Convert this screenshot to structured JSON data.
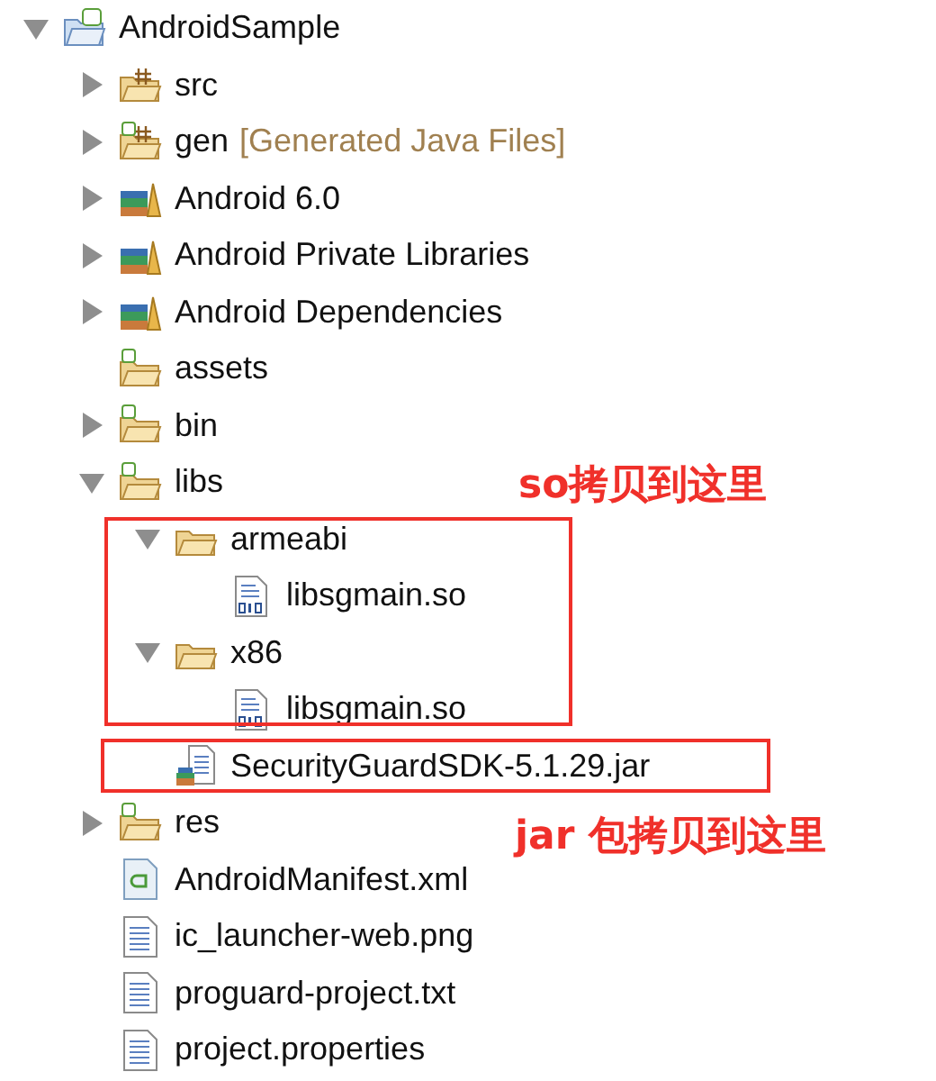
{
  "tree": {
    "label": "AndroidSample",
    "kind": "project",
    "expanded": true,
    "children": [
      {
        "label": "src",
        "kind": "package-folder",
        "expanded": false
      },
      {
        "label": "gen",
        "note": "[Generated Java Files]",
        "kind": "android-package-folder",
        "expanded": false
      },
      {
        "label": "Android 6.0",
        "kind": "library",
        "expanded": false
      },
      {
        "label": "Android Private Libraries",
        "kind": "library",
        "expanded": false
      },
      {
        "label": "Android Dependencies",
        "kind": "library",
        "expanded": false
      },
      {
        "label": "assets",
        "kind": "android-folder"
      },
      {
        "label": "bin",
        "kind": "android-folder",
        "expanded": false
      },
      {
        "label": "libs",
        "kind": "android-folder",
        "expanded": true,
        "children": [
          {
            "label": "armeabi",
            "kind": "folder",
            "expanded": true,
            "children": [
              {
                "label": "libsgmain.so",
                "kind": "binary"
              }
            ]
          },
          {
            "label": "x86",
            "kind": "folder",
            "expanded": true,
            "children": [
              {
                "label": "libsgmain.so",
                "kind": "binary"
              }
            ]
          },
          {
            "label": "SecurityGuardSDK-5.1.29.jar",
            "kind": "jar"
          }
        ]
      },
      {
        "label": "res",
        "kind": "android-folder",
        "expanded": false
      },
      {
        "label": "AndroidManifest.xml",
        "kind": "manifest"
      },
      {
        "label": "ic_launcher-web.png",
        "kind": "text-file"
      },
      {
        "label": "proguard-project.txt",
        "kind": "text-file"
      },
      {
        "label": "project.properties",
        "kind": "text-file"
      }
    ]
  },
  "annotations": [
    {
      "text": "so拷贝到这里"
    },
    {
      "text": "jar 包拷贝到这里"
    }
  ]
}
